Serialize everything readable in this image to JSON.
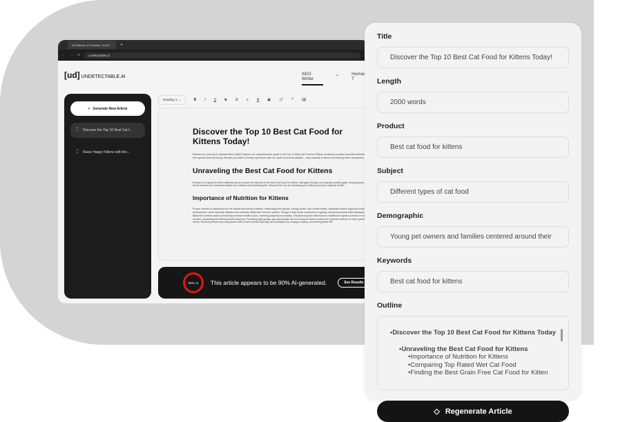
{
  "browser": {
    "tab_title": "AI Detector, AI Checker, & AI H",
    "url": "undetectable.ai"
  },
  "app": {
    "logo_mark": "[ud]",
    "logo_text": "UNDETECTABLE.AI",
    "nav": [
      "SEO Writer",
      "Human T"
    ]
  },
  "sidebar": {
    "generate_label": "Generate New Article",
    "items": [
      "Discover the Top 10 Best Cat f...",
      "Raise Happy Kittens with the..."
    ]
  },
  "toolbar": {
    "heading_select": "Heading 1",
    "buttons": [
      "B",
      "I",
      "U",
      "S",
      "☰",
      "≡",
      "A",
      "▣",
      "🔗",
      "❞",
      "🖼"
    ]
  },
  "article": {
    "h1": "Discover the Top 10 Best Cat Food for Kittens Today!",
    "p1": "Embark on a journey to optimal feline health! Explore our comprehensive guide to the Top 10 Best Cat Food for Kittens, curated to provide essential nutrients for their growth and well-being. Elevate your kitten's dining experience with our expert recommendations – step towards a vibrant and thriving feline companion!",
    "h2": "Unraveling the Best Cat Food for Kittens",
    "p2": "Embark on a quest for feline wellness as we unravel the secrets to the Best Cat Food for Kittens. Navigate through our expertly curated guide, ensuring your furry friend receives the essential nutrition for a vibrant and flourishing life. Discover the key to nourishing your kitten's journey to optimal health!",
    "h3": "Importance of Nutrition for Kittens",
    "p3": "Proper nutrition is paramount for the holistic well-being of kittens, influencing their growth, energy levels, and overall health. Adequate protein supports muscle development, while essential vitamins and minerals fortify their immune system. Omega-3 fatty acids contribute to a glossy coat and promote brain development. Balanced nutrition aids in preventing common health issues, fostering longevity and vitality. Transitioning from kittenhood to adulthood requires precision in dietary choices, impacting their lifelong health trajectory. Providing high-quality, age-appropriate cat food ensures kittens receive the optimal nutrients for their specific needs. Nurturing these furry companions with a well-rounded diet lays the foundation for a happy, healthy, and thriving feline life."
  },
  "ai_result": {
    "badge": "90% AI",
    "percent": 90,
    "message": "This article appears to be 90% AI-generated.",
    "button": "See Results",
    "ring_color": "#e11111"
  },
  "form": {
    "title_label": "Title",
    "title_value": "Discover the Top 10 Best Cat Food for Kittens Today!",
    "length_label": "Length",
    "length_value": "2000 words",
    "product_label": "Product",
    "product_value": "Best cat food for kittens",
    "subject_label": "Subject",
    "subject_value": "Different types of cat food",
    "demographic_label": "Demographic",
    "demographic_value": "Young pet owners and families centered around their",
    "keywords_label": "Keywords",
    "keywords_value": "Best cat food for kittens",
    "outline_label": "Outline",
    "outline": [
      "•Discover the Top 10 Best Cat Food for Kittens Today",
      "•Unraveling the Best Cat Food for Kittens",
      "•Importance of Nutrition for Kittens",
      "•Comparing Top Rated Wet Cat Food",
      "•Finding the Best Grain Free Cat Food for Kitten"
    ],
    "regenerate_label": "Regenerate Article"
  }
}
